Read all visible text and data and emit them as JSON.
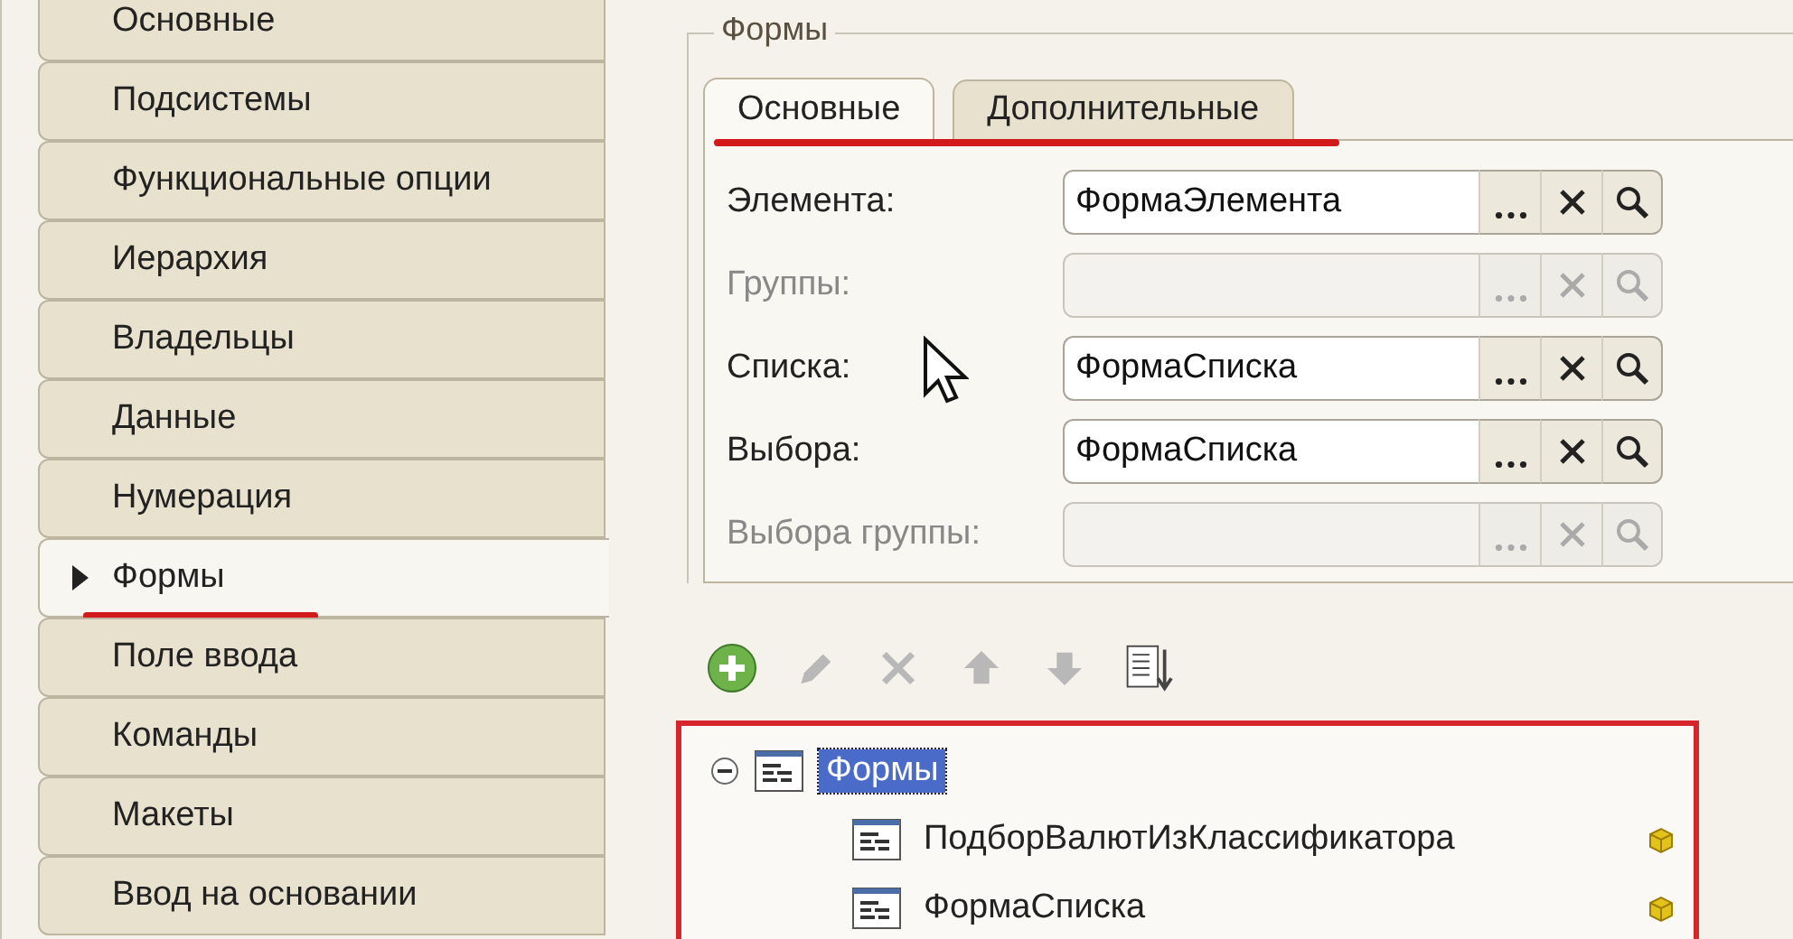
{
  "sidebar": {
    "items": [
      {
        "label": "Основные",
        "selected": false,
        "underlined": false
      },
      {
        "label": "Подсистемы",
        "selected": false,
        "underlined": false
      },
      {
        "label": "Функциональные опции",
        "selected": false,
        "underlined": false
      },
      {
        "label": "Иерархия",
        "selected": false,
        "underlined": false
      },
      {
        "label": "Владельцы",
        "selected": false,
        "underlined": false
      },
      {
        "label": "Данные",
        "selected": false,
        "underlined": false
      },
      {
        "label": "Нумерация",
        "selected": false,
        "underlined": false
      },
      {
        "label": "Формы",
        "selected": true,
        "underlined": true
      },
      {
        "label": "Поле ввода",
        "selected": false,
        "underlined": false
      },
      {
        "label": "Команды",
        "selected": false,
        "underlined": false
      },
      {
        "label": "Макеты",
        "selected": false,
        "underlined": false
      },
      {
        "label": "Ввод на основании",
        "selected": false,
        "underlined": false
      }
    ]
  },
  "group": {
    "title": "Формы",
    "tabs": [
      {
        "label": "Основные",
        "selected": true
      },
      {
        "label": "Дополнительные",
        "selected": false
      }
    ],
    "tabs_underlined": true,
    "fields": [
      {
        "label": "Элемента:",
        "value": "ФормаЭлемента",
        "disabled": false
      },
      {
        "label": "Группы:",
        "disabled": true
      },
      {
        "label": "Списка:",
        "value": "ФормаСписка",
        "disabled": false
      },
      {
        "label": "Выбора:",
        "value": "ФормаСписка",
        "disabled": false
      },
      {
        "label": "Выбора группы:",
        "disabled": true
      }
    ]
  },
  "toolbar": [
    {
      "kind": "add",
      "disabled": false
    },
    {
      "kind": "edit",
      "disabled": true
    },
    {
      "kind": "delete",
      "disabled": true
    },
    {
      "kind": "up",
      "disabled": true
    },
    {
      "kind": "down",
      "disabled": true
    },
    {
      "kind": "sort",
      "disabled": false
    }
  ],
  "tree": {
    "outlined": true,
    "items": [
      {
        "label": "Формы",
        "selected": true,
        "expanded": true,
        "children": [
          {
            "label": "ПодборВалютИзКлассификатора",
            "selected": false
          },
          {
            "label": "ФормаСписка",
            "selected": false
          }
        ]
      }
    ]
  }
}
